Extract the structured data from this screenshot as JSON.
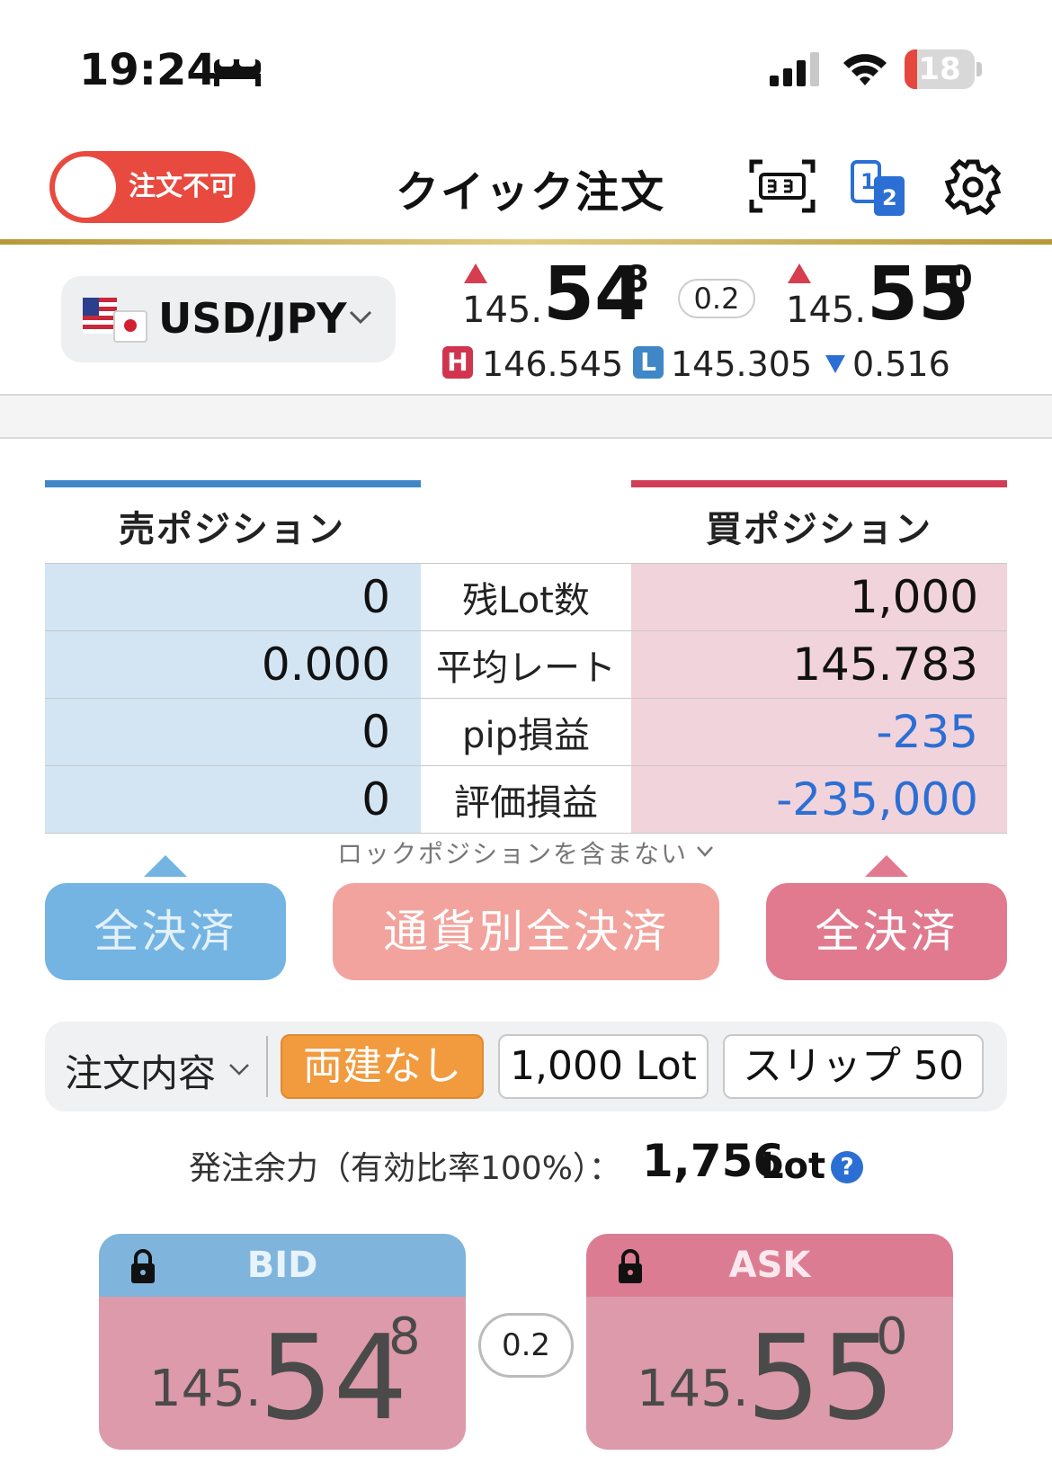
{
  "status_bar": {
    "time": "19:24",
    "battery": "18",
    "battery_level": 0.18,
    "icons": [
      "bed-icon",
      "signal-icon",
      "wifi-icon",
      "battery-icon"
    ]
  },
  "header": {
    "toggle_label": "注文不可",
    "title": "クイック注文",
    "icons": [
      "scan-icon",
      "split-view-icon",
      "gear-icon"
    ],
    "split_icon_left": "1",
    "split_icon_right": "2"
  },
  "rate": {
    "pair": "USD/JPY",
    "bid": {
      "prefix": "145.",
      "main": "54",
      "sup": "8"
    },
    "ask": {
      "prefix": "145.",
      "main": "55",
      "sup": "0"
    },
    "spread": "0.2",
    "high_label": "H",
    "high": "146.545",
    "low_label": "L",
    "low": "145.305",
    "change": "0.516"
  },
  "positions": {
    "sell_header": "売ポジション",
    "buy_header": "買ポジション",
    "rows": [
      {
        "sell": "0",
        "label": "残Lot数",
        "buy": "1,000"
      },
      {
        "sell": "0.000",
        "label": "平均レート",
        "buy": "145.783"
      },
      {
        "sell": "0",
        "label": "pip損益",
        "buy": "-235"
      },
      {
        "sell": "0",
        "label": "評価損益",
        "buy": "-235,000"
      }
    ],
    "lock_note": "ロックポジションを含まない"
  },
  "actions": {
    "close_sell": "全決済",
    "close_pair": "通貨別全決済",
    "close_buy": "全決済"
  },
  "order": {
    "content_label": "注文内容",
    "hedge": "両建なし",
    "lot": "1,000 Lot",
    "slip": "スリップ 50",
    "capacity_label": "発注余力（有効比率100%）：",
    "capacity_value": "1,756",
    "capacity_unit": "Lot",
    "help": "?"
  },
  "trade": {
    "bid_label": "BID",
    "ask_label": "ASK",
    "bid": {
      "prefix": "145.",
      "main": "54",
      "sup": "8"
    },
    "ask": {
      "prefix": "145.",
      "main": "55",
      "sup": "0"
    },
    "spread": "0.2"
  },
  "colors": {
    "accent_red": "#e84a3f",
    "sell_blue": "#3f87c6",
    "buy_red": "#d03d57",
    "negative": "#2c6fd4",
    "hedge_orange": "#f19a3e"
  }
}
